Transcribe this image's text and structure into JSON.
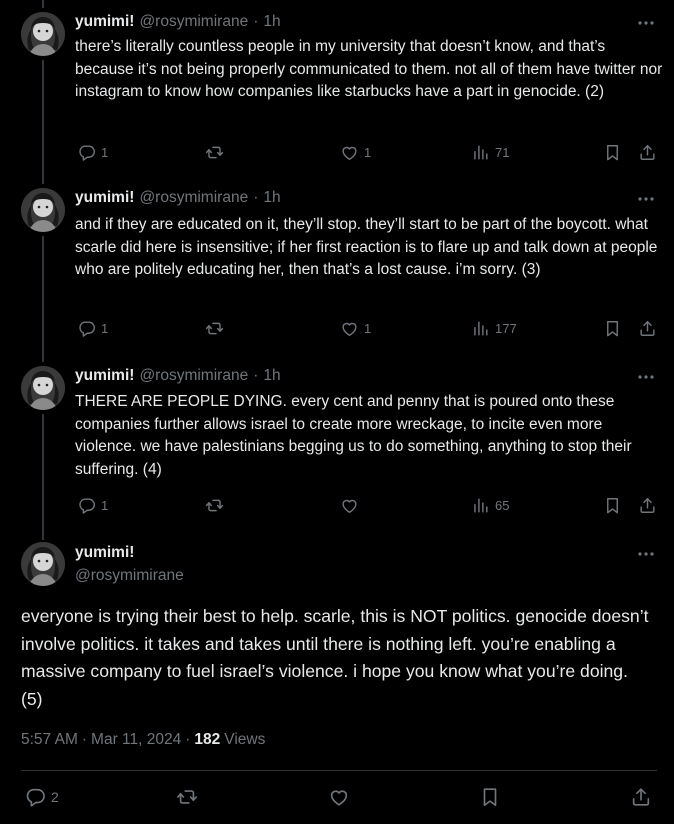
{
  "tweets": [
    {
      "name": "yumimi!",
      "handle": "@rosymimirane",
      "time_separator": "·",
      "time": "1h",
      "text": "there’s literally countless people in my university that doesn’t know, and that’s because it’s not being properly communicated to them. not all of them have twitter nor instagram to know how companies like starbucks have a part in genocide. (2)",
      "replies": "1",
      "retweets": "",
      "likes": "1",
      "views": "71"
    },
    {
      "name": "yumimi!",
      "handle": "@rosymimirane",
      "time_separator": "·",
      "time": "1h",
      "text": "and if they are educated on it, they’ll stop. they’ll start to be part of the boycott. what scarle did here is insensitive; if her first reaction is to flare up and talk down at people who are politely educating her, then that’s a lost cause. i’m sorry. (3)",
      "replies": "1",
      "retweets": "",
      "likes": "1",
      "views": "177"
    },
    {
      "name": "yumimi!",
      "handle": "@rosymimirane",
      "time_separator": "·",
      "time": "1h",
      "text": "THERE ARE PEOPLE DYING. every cent and penny that is poured onto these companies further allows israel to create more wreckage, to incite even more violence. we have palestinians begging us to do something, anything to stop their suffering. (4)",
      "replies": "1",
      "retweets": "",
      "likes": "",
      "views": "65"
    }
  ],
  "main_tweet": {
    "name": "yumimi!",
    "handle": "@rosymimirane",
    "text": "everyone is trying their best to help. scarle, this is NOT politics. genocide doesn’t involve politics. it takes and takes until there is nothing left. you’re enabling a massive company to fuel israel’s violence. i hope you know what you’re doing. (5)",
    "time": "5:57 AM",
    "date": "Mar 11, 2024",
    "separator": "·",
    "views_count": "182",
    "views_label": "Views",
    "replies": "2",
    "retweets": "",
    "likes": ""
  },
  "icons": {
    "more": "more-horizontal-icon",
    "reply": "reply-icon",
    "retweet": "retweet-icon",
    "like": "heart-icon",
    "views": "views-bar-icon",
    "bookmark": "bookmark-icon",
    "share": "share-icon"
  },
  "colors": {
    "background": "#000000",
    "text": "#e7e9ea",
    "muted": "#71767b",
    "thread_line": "#333639"
  }
}
